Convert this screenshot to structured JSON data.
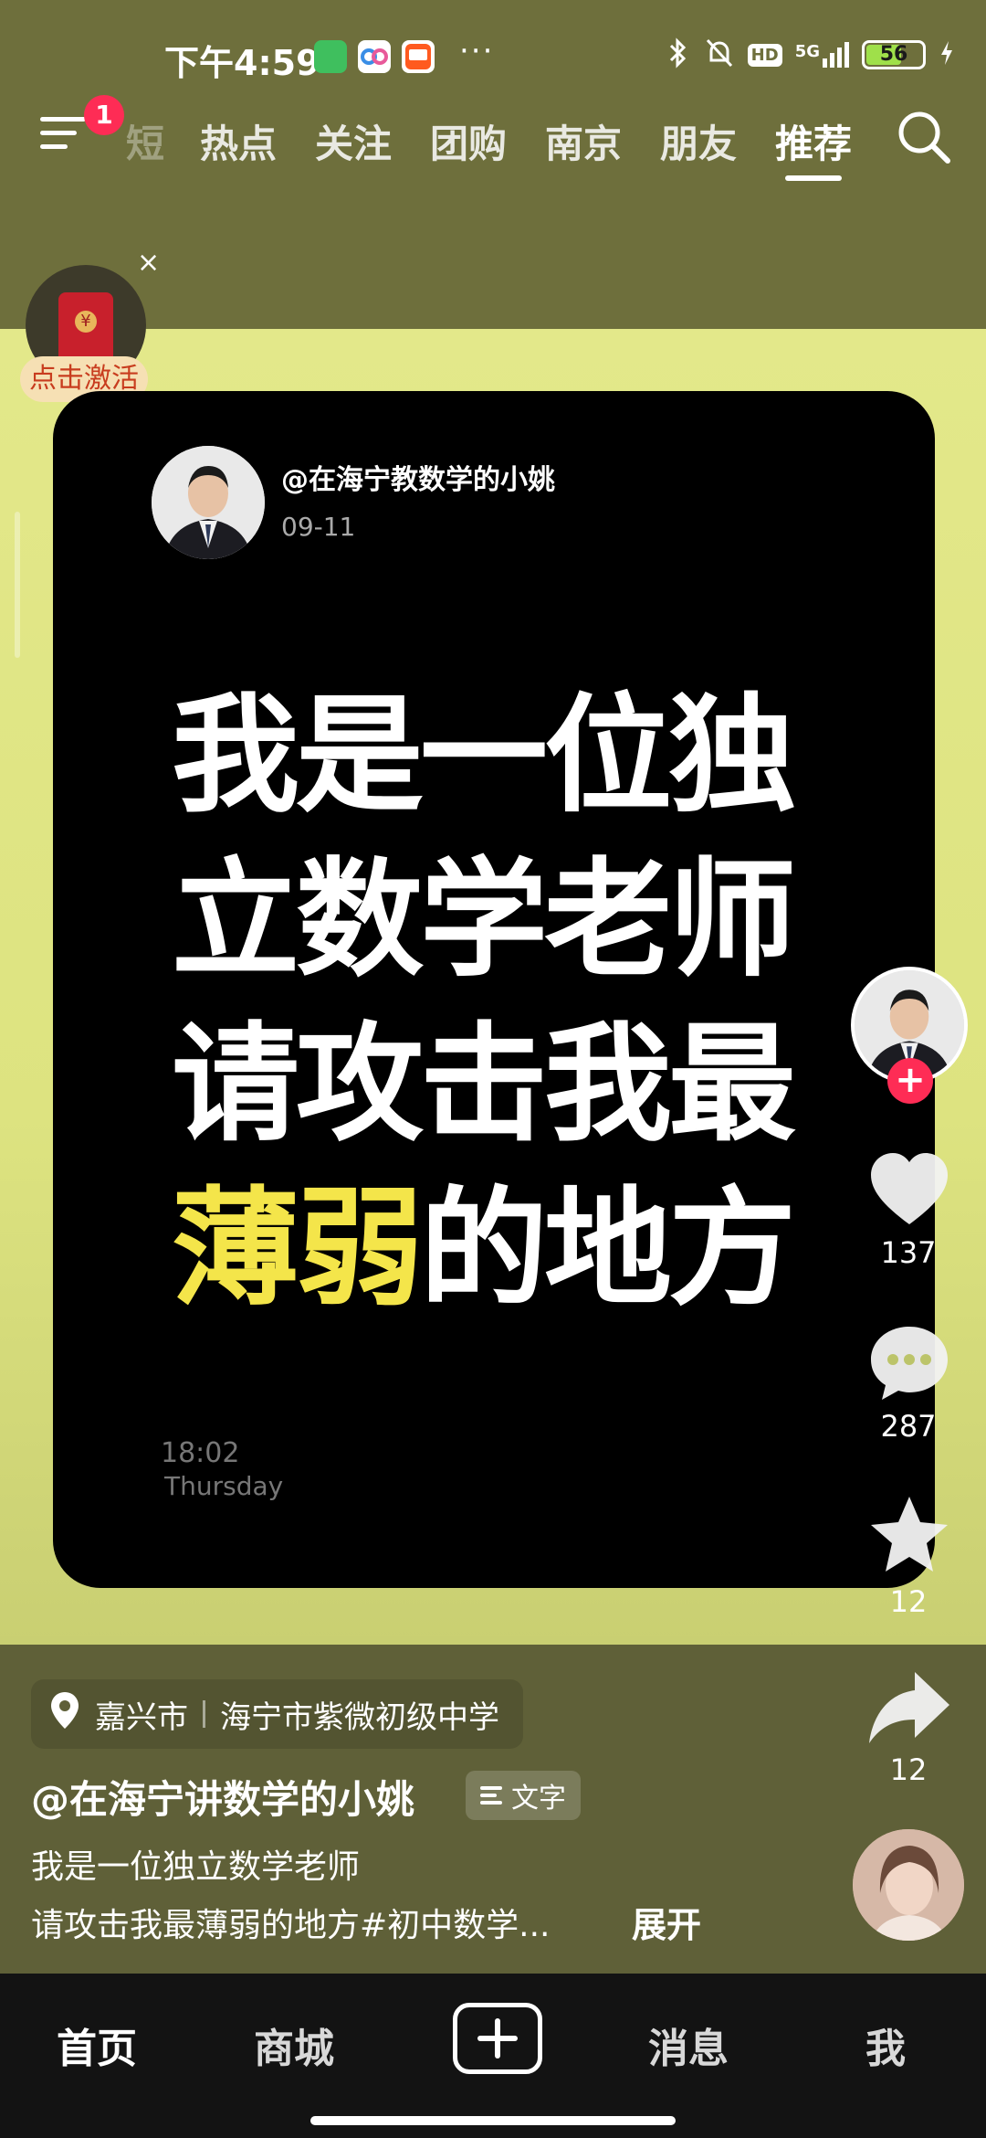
{
  "status_bar": {
    "time": "下午4:59",
    "more": "···",
    "network": "5G",
    "hd": "HD",
    "battery": "56"
  },
  "top_nav": {
    "badge": "1",
    "tabs": [
      "热点",
      "关注",
      "团购",
      "南京",
      "朋友",
      "推荐"
    ],
    "partial_tab": "短",
    "active_tab": "推荐"
  },
  "promo": {
    "close": "×",
    "label": "点击激活"
  },
  "post_card": {
    "author": "@在海宁教数学的小姚",
    "date": "09-11",
    "lines": [
      "我是一位独",
      "立数学老师",
      "请攻击我最"
    ],
    "last_line_highlight": "薄弱",
    "last_line_rest": "的地方",
    "time": "18:02",
    "day": "Thursday"
  },
  "rail": {
    "follow": "+",
    "likes": "137",
    "comments": "287",
    "favorites": "12",
    "shares": "12"
  },
  "info": {
    "location_city": "嘉兴市",
    "location_place": "海宁市紫微初级中学",
    "author": "@在海宁讲数学的小姚",
    "tag": "文字",
    "desc_line1": "我是一位独立数学老师",
    "desc_line2": "请攻击我最薄弱的地方#初中数学...",
    "expand": "展开"
  },
  "tabbar": {
    "home": "首页",
    "mall": "商城",
    "messages": "消息",
    "me": "我"
  },
  "colors": {
    "accent_red": "#fe2c55",
    "highlight_yellow": "#f4e54a",
    "background_yellow": "#e3e88a"
  }
}
